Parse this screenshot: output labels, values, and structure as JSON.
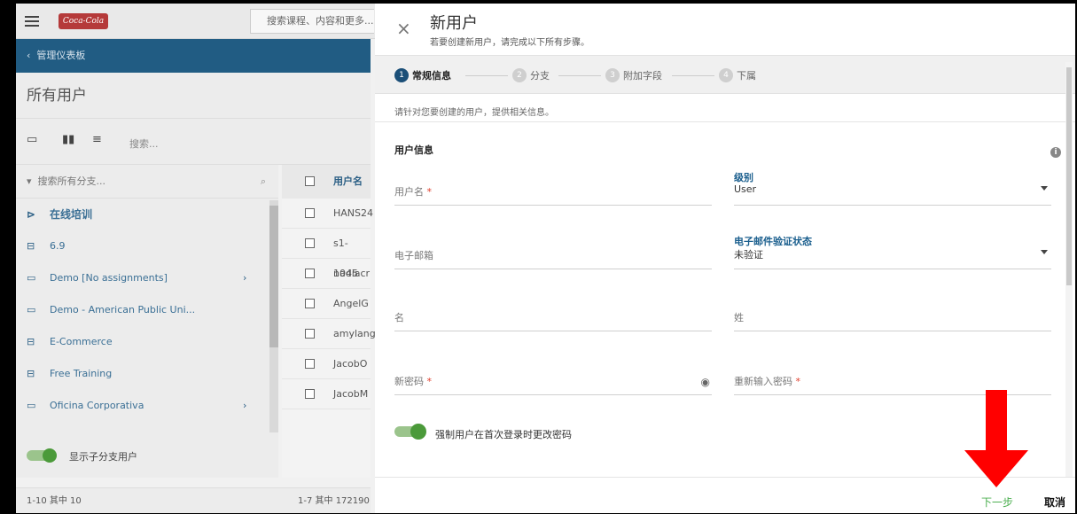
{
  "app": {
    "logo_text": "Coca-Cola",
    "top_search_placeholder": "搜索课程、内容和更多..."
  },
  "left": {
    "back_label": "管理仪表板",
    "page_title": "所有用户",
    "search_placeholder": "搜索...",
    "branch_search_placeholder": "搜索所有分支...",
    "tree": [
      {
        "label": "在线培训",
        "icon": "folder-open-icon",
        "bold": true,
        "chevron": false
      },
      {
        "label": "6.9",
        "icon": "laptop-icon",
        "bold": false,
        "chevron": false
      },
      {
        "label": "Demo [No assignments]",
        "icon": "folder-icon",
        "bold": false,
        "chevron": true
      },
      {
        "label": "Demo - American Public Uni...",
        "icon": "folder-icon",
        "bold": false,
        "chevron": false
      },
      {
        "label": "E-Commerce",
        "icon": "laptop-icon",
        "bold": false,
        "chevron": false
      },
      {
        "label": "Free Training",
        "icon": "laptop-icon",
        "bold": false,
        "chevron": false
      },
      {
        "label": "Oficina Corporativa",
        "icon": "folder-icon",
        "bold": false,
        "chevron": true
      }
    ],
    "show_sub_label": "显示子分支用户",
    "footer_left": "1-10 其中 10",
    "footer_right": "1-7 其中 172190"
  },
  "table": {
    "header": "用户名",
    "rows": [
      "HANS24",
      "s1-1045",
      "nadiacr",
      "AngelG",
      "amylang",
      "JacobO",
      "JacobM"
    ]
  },
  "panel": {
    "close_glyph": "×",
    "title": "新用户",
    "subtitle": "若要创建新用户，请完成以下所有步骤。",
    "steps": [
      {
        "num": "1",
        "label": "常规信息",
        "active": true
      },
      {
        "num": "2",
        "label": "分支",
        "active": false
      },
      {
        "num": "3",
        "label": "附加字段",
        "active": false
      },
      {
        "num": "4",
        "label": "下属",
        "active": false
      }
    ],
    "description": "请针对您要创建的用户，提供相关信息。",
    "section_title": "用户信息",
    "info_glyph": "i",
    "fields": {
      "username": "用户名",
      "email": "电子邮箱",
      "first_name": "名",
      "last_name": "姓",
      "new_password": "新密码",
      "retype_password": "重新输入密码",
      "required_mark": "*"
    },
    "level": {
      "label": "级别",
      "value": "User"
    },
    "email_status": {
      "label": "电子邮件验证状态",
      "value": "未验证"
    },
    "force_change_label": "强制用户在首次登录时更改密码",
    "next_label": "下一步",
    "cancel_label": "取消"
  },
  "colors": {
    "accent_blue": "#1b4f78",
    "toggle_green": "#4b9a3a",
    "next_green": "#4caf50",
    "required_red": "#e0402e",
    "annotation_arrow": "#ff0000"
  }
}
